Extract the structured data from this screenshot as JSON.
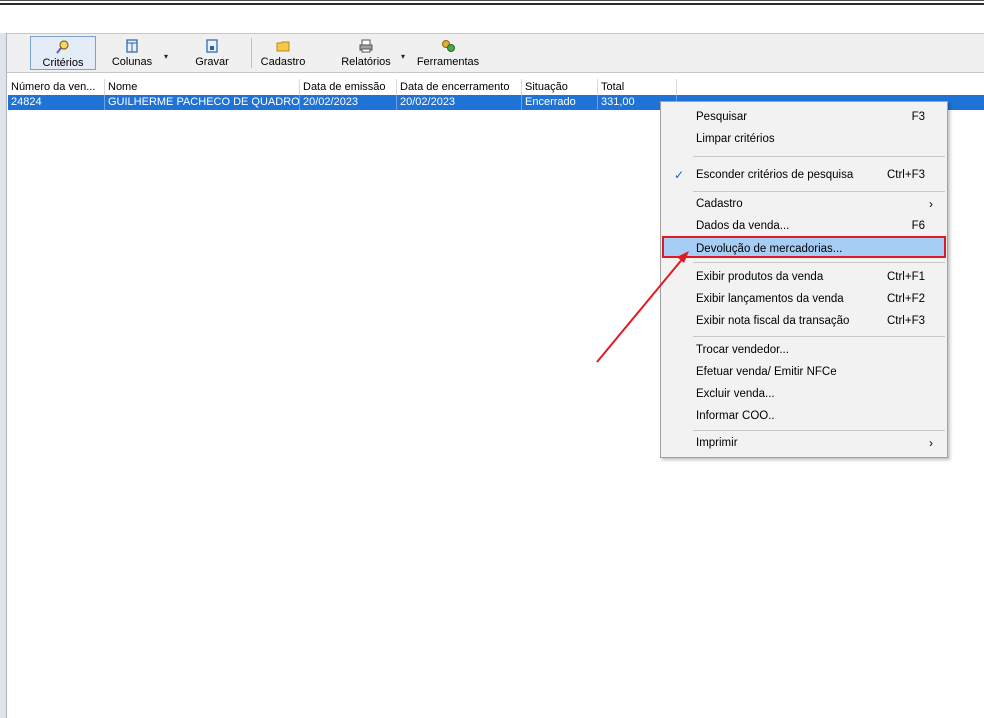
{
  "toolbar": {
    "criterios": "Critérios",
    "colunas": "Colunas",
    "gravar": "Gravar",
    "cadastro": "Cadastro",
    "relatorios": "Relatórios",
    "ferramentas": "Ferramentas"
  },
  "grid": {
    "columns": [
      "Número da ven...",
      "Nome",
      "Data de emissão",
      "Data de encerramento",
      "Situação",
      "Total"
    ],
    "rows": [
      {
        "numero": "24824",
        "nome": "GUILHERME PACHECO DE QUADROS",
        "emissao": "20/02/2023",
        "encerramento": "20/02/2023",
        "situacao": "Encerrado",
        "total": "331,00"
      }
    ]
  },
  "menu": {
    "pesquisar": {
      "label": "Pesquisar",
      "shortcut": "F3"
    },
    "limpar": {
      "label": "Limpar critérios"
    },
    "esconder": {
      "label": "Esconder critérios de pesquisa",
      "shortcut": "Ctrl+F3"
    },
    "cadastro": {
      "label": "Cadastro"
    },
    "dados": {
      "label": "Dados da venda...",
      "shortcut": "F6"
    },
    "devolucao": {
      "label": "Devolução de mercadorias..."
    },
    "produtos": {
      "label": "Exibir produtos da venda",
      "shortcut": "Ctrl+F1"
    },
    "lancamentos": {
      "label": "Exibir lançamentos da venda",
      "shortcut": "Ctrl+F2"
    },
    "nota": {
      "label": "Exibir nota fiscal da transação",
      "shortcut": "Ctrl+F3"
    },
    "trocar": {
      "label": "Trocar vendedor..."
    },
    "efetuar": {
      "label": "Efetuar venda/ Emitir NFCe"
    },
    "excluir": {
      "label": "Excluir venda..."
    },
    "coo": {
      "label": "Informar COO.."
    },
    "imprimir": {
      "label": "Imprimir"
    }
  },
  "colors": {
    "selection": "#1f73d6",
    "highlight": "#a6cdf3",
    "annotation": "#e01a22"
  }
}
